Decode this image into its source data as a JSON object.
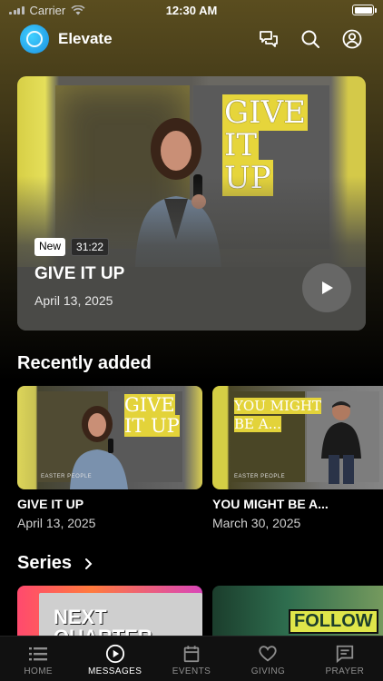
{
  "status_bar": {
    "carrier": "Carrier",
    "time": "12:30 AM",
    "battery_level": 1.0
  },
  "header": {
    "app_name": "Elevate",
    "icons": [
      "chat-icon",
      "search-icon",
      "profile-icon"
    ]
  },
  "hero": {
    "art_title_line1": "GIVE",
    "art_title_line2": "IT UP",
    "badge_new": "New",
    "duration": "31:22",
    "title": "GIVE IT UP",
    "date": "April 13, 2025"
  },
  "recently_added": {
    "heading": "Recently added",
    "items": [
      {
        "title": "GIVE IT UP",
        "date": "April 13, 2025",
        "art_line1": "GIVE",
        "art_line2": "IT UP",
        "caption": "EASTER PEOPLE"
      },
      {
        "title": "YOU MIGHT BE A...",
        "date": "March 30, 2025",
        "art_line1": "YOU MIGHT",
        "art_line2": "BE A...",
        "caption": "EASTER PEOPLE"
      }
    ]
  },
  "series": {
    "heading": "Series",
    "items": [
      {
        "label": "NEXT QUARTER"
      },
      {
        "label": "FOLLOW"
      }
    ]
  },
  "tabs": [
    {
      "label": "HOME",
      "icon": "list-icon",
      "active": false
    },
    {
      "label": "MESSAGES",
      "icon": "play-circle-icon",
      "active": true
    },
    {
      "label": "EVENTS",
      "icon": "calendar-icon",
      "active": false
    },
    {
      "label": "GIVING",
      "icon": "heart-icon",
      "active": false
    },
    {
      "label": "PRAYER",
      "icon": "message-square-icon",
      "active": false
    }
  ],
  "colors": {
    "accent_yellow": "#e6d53b",
    "logo_blue": "#2aa8f0",
    "background": "#000000"
  }
}
